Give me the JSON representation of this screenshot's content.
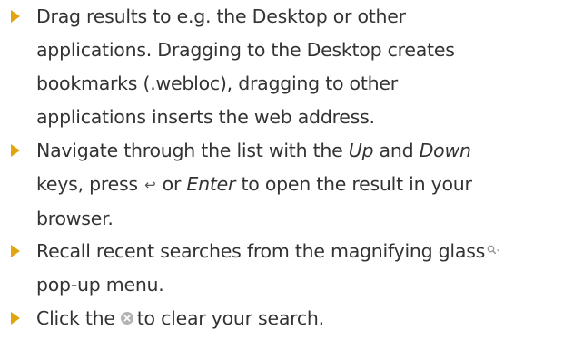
{
  "colors": {
    "bullet": "#e1a512",
    "text": "#333333",
    "icon_gray": "#a8a8a8"
  },
  "tips": [
    {
      "line_1": "Drag results to e.g. the Desktop or other",
      "line_2": "applications. Dragging to the Desktop creates",
      "line_3": "bookmarks (.webloc), dragging to other",
      "line_4": "applications inserts the web address."
    },
    {
      "l1_a": "Navigate through the list with the ",
      "l1_up": "Up",
      "l1_b": " and ",
      "l1_down": "Down",
      "l2_a": "keys, press ",
      "l2_return_icon": "↩",
      "l2_b": " or ",
      "l2_enter": "Enter",
      "l2_c": " to open the result in your",
      "line_3": "browser."
    },
    {
      "l1_text": "Recall recent searches from the magnifying glass",
      "l1_icon": "magnifying-glass-menu-icon",
      "line_2": "pop-up menu."
    },
    {
      "text_a": "Click the",
      "icon": "clear-search-icon",
      "text_b": "to clear your search."
    }
  ]
}
